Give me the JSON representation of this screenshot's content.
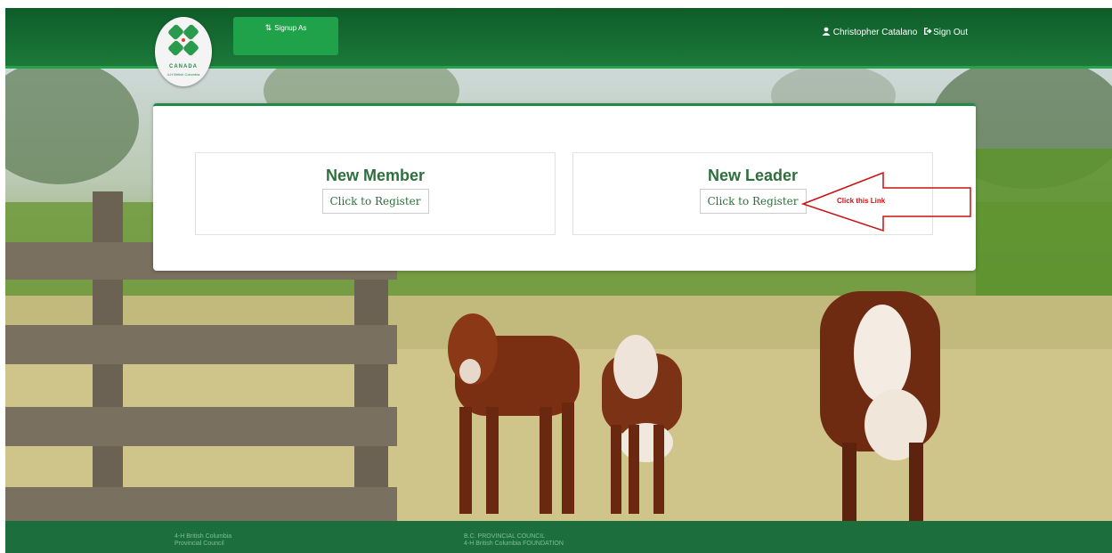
{
  "header": {
    "logo_text": "CANADA",
    "logo_subtext": "4-H British Columbia",
    "signup_label": "Signup As",
    "user_name": "Christopher Catalano",
    "signout_label": "Sign Out"
  },
  "icons": {
    "signup": "retweet-icon",
    "user": "user-icon",
    "signout": "sign-out-icon",
    "logo": "clover-icon"
  },
  "card": {
    "panels": [
      {
        "title": "New Member",
        "button_label": "Click to Register"
      },
      {
        "title": "New Leader",
        "button_label": "Click to Register"
      }
    ]
  },
  "annotation": {
    "label": "Click this Link",
    "color": "#cc1111"
  },
  "footer": {
    "left_lines": [
      "4-H British Columbia",
      "Provincial Council"
    ],
    "right_lines": [
      "B.C. PROVINCIAL COUNCIL",
      "4-H British Columbia FOUNDATION"
    ]
  },
  "colors": {
    "header": "#1b7a3a",
    "signup_button": "#20a24a",
    "accent": "#1f8a44",
    "title_text": "#2e6f3b",
    "footer": "#1c6e3d"
  }
}
